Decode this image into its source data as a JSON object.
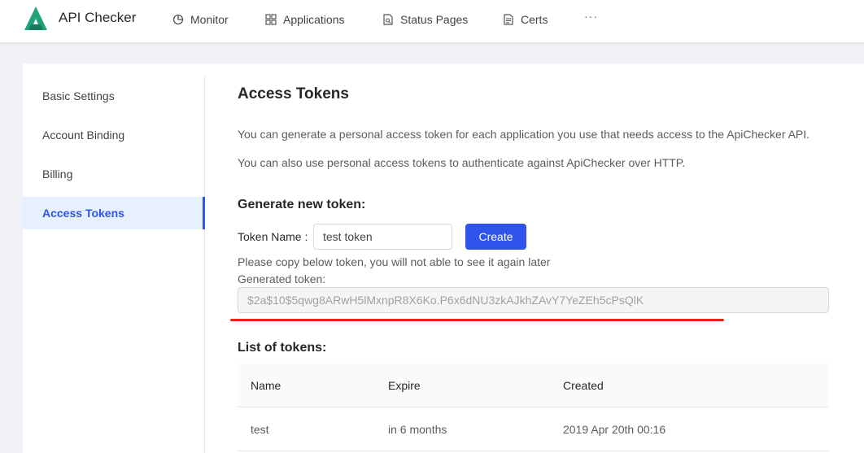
{
  "app": {
    "name": "API Checker",
    "brand_color": "#1fa37a",
    "accent_color": "#2f54eb"
  },
  "nav": {
    "items": [
      {
        "label": "Monitor",
        "icon": "pie-chart-icon"
      },
      {
        "label": "Applications",
        "icon": "grid-icon"
      },
      {
        "label": "Status Pages",
        "icon": "file-search-icon"
      },
      {
        "label": "Certs",
        "icon": "certificate-icon"
      }
    ],
    "more": "···"
  },
  "sidebar": {
    "items": [
      {
        "label": "Basic Settings",
        "active": false
      },
      {
        "label": "Account Binding",
        "active": false
      },
      {
        "label": "Billing",
        "active": false
      },
      {
        "label": "Access Tokens",
        "active": true
      }
    ]
  },
  "main": {
    "title": "Access Tokens",
    "desc1": "You can generate a personal access token for each application you use that needs access to the ApiChecker API.",
    "desc2": "You can also use personal access tokens to authenticate against ApiChecker over HTTP.",
    "generate_heading": "Generate new token:",
    "token_name_label": "Token Name",
    "token_name_value": "test token",
    "create_label": "Create",
    "copy_notice": "Please copy below token, you will not able to see it again later",
    "generated_label": "Generated token:",
    "generated_token": "$2a$10$5qwg8ARwH5lMxnpR8X6Ko.P6x6dNU3zkAJkhZAvY7YeZEh5cPsQlK",
    "list_heading": "List of tokens:",
    "table": {
      "columns": [
        "Name",
        "Expire",
        "Created"
      ],
      "rows": [
        [
          "test",
          "in 6 months",
          "2019 Apr 20th 00:16"
        ]
      ]
    }
  }
}
